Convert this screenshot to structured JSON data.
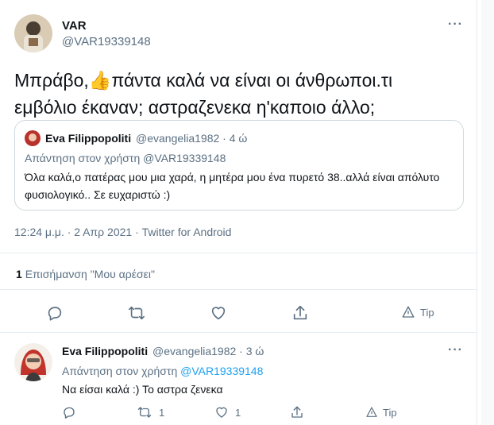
{
  "main_tweet": {
    "author_name": "VAR",
    "author_handle": "@VAR19339148",
    "more_label": "···",
    "text_line1": "Μπράβο,👍πάντα καλά να είναι οι άνθρωποι.τι",
    "text_line2": "εμβόλιο έκαναν; αστραζενεκα η'καποιο άλλο;",
    "quote": {
      "author_name": "Eva Filippopoliti",
      "author_handle": "@evangelia1982 · 4 ώ",
      "reply_prefix": "Απάντηση στον χρήστη ",
      "reply_handle": "@VAR19339148",
      "text": "Όλα καλά,ο πατέρας μου μια χαρά, η μητέρα μου ένα πυρετό 38..αλλά είναι απόλυτο φυσιολογικό.. Σε ευχαριστώ :)"
    },
    "meta": "12:24 μ.μ. · 2 Απρ 2021 · Twitter for Android",
    "likes_count": "1",
    "likes_label": "Επισήμανση \"Μου αρέσει\"",
    "tip_label": "Tip"
  },
  "reply_tweet": {
    "author_name": "Eva Filippopoliti",
    "author_handle": "@evangelia1982 · 3 ώ",
    "more_label": "···",
    "reply_prefix": "Απάντηση στον χρήστη ",
    "reply_handle": "@VAR19339148",
    "text": "Να είσαι καλά :) Το αστρα ζενεκα",
    "retweet_count": "1",
    "like_count": "1",
    "tip_label": "Tip"
  },
  "colors": {
    "accent": "#1da1f2",
    "muted": "#5b7083",
    "border": "#e6ecf0"
  },
  "icons": [
    "reply-icon",
    "retweet-icon",
    "like-icon",
    "share-icon",
    "tip-icon",
    "more-icon"
  ]
}
